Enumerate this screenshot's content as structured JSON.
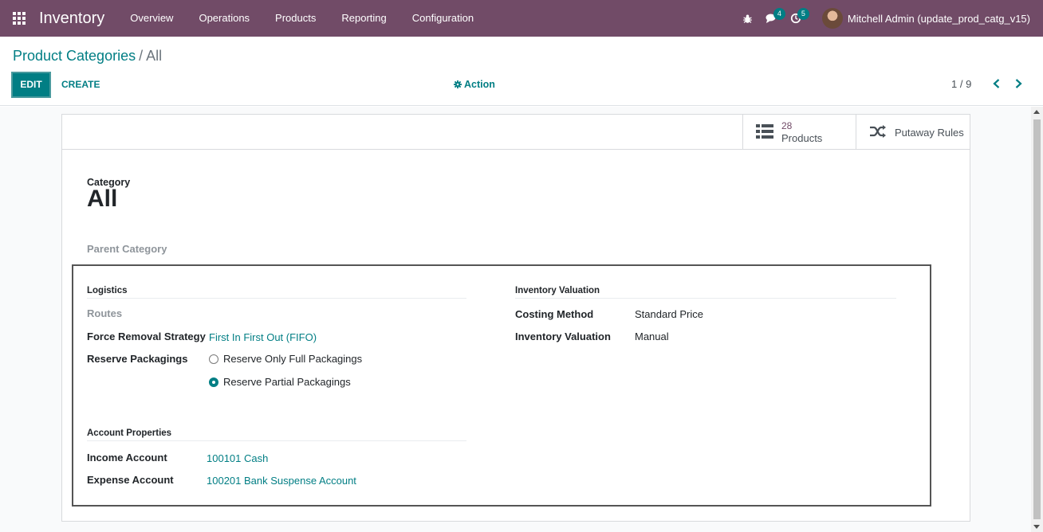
{
  "navbar": {
    "app_name": "Inventory",
    "menu": [
      "Overview",
      "Operations",
      "Products",
      "Reporting",
      "Configuration"
    ],
    "messages_count": "4",
    "activities_count": "5",
    "user_name": "Mitchell Admin (update_prod_catg_v15)",
    "color": "#714B67"
  },
  "breadcrumb": {
    "parent": "Product Categories",
    "separator": "/",
    "current": "All"
  },
  "buttons": {
    "edit": "EDIT",
    "create": "CREATE",
    "action": "Action"
  },
  "pager": {
    "value": "1 / 9"
  },
  "smart_buttons": {
    "products_count": "28",
    "products_label": "Products",
    "putaway_label": "Putaway Rules"
  },
  "form": {
    "category_label": "Category",
    "name": "All",
    "parent_category_label": "Parent Category",
    "logistics": {
      "title": "Logistics",
      "routes_label": "Routes",
      "removal_label": "Force Removal Strategy",
      "removal_value": "First In First Out (FIFO)",
      "reserve_label": "Reserve Packagings",
      "reserve_options": [
        "Reserve Only Full Packagings",
        "Reserve Partial Packagings"
      ],
      "reserve_selected": 1
    },
    "valuation": {
      "title": "Inventory Valuation",
      "costing_label": "Costing Method",
      "costing_value": "Standard Price",
      "valuation_label": "Inventory Valuation",
      "valuation_value": "Manual"
    },
    "accounts": {
      "title": "Account Properties",
      "income_label": "Income Account",
      "income_value": "100101 Cash",
      "expense_label": "Expense Account",
      "expense_value": "100201 Bank Suspense Account"
    }
  },
  "colors": {
    "accent": "#017e84",
    "brand": "#714B67"
  }
}
